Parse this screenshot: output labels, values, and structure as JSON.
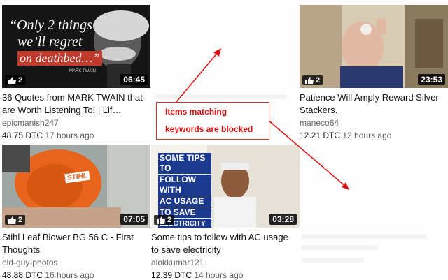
{
  "videos": [
    {
      "title": "36 Quotes from MARK TWAIN that are Worth Listening To! | Lif…",
      "channel": "epicmanish247",
      "dtc": "48.75 DTC",
      "age": "17 hours ago",
      "likes": "2",
      "duration": "06:45",
      "thumb_line1": "“Only 2 things",
      "thumb_line2": "we’ll regret",
      "thumb_line3": "on deathbed…”",
      "thumb_caption": "MARK TWAIN"
    },
    {
      "title": "Patience Will Amply Reward Silver Stackers.",
      "channel": "maneco64",
      "dtc": "12.21 DTC",
      "age": "12 hours ago",
      "likes": "2",
      "duration": "23:53"
    },
    {
      "title": "Stihl Leaf Blower BG 56 C - First Thoughts",
      "channel": "old-guy-photos",
      "dtc": "48.88 DTC",
      "age": "16 hours ago",
      "likes": "2",
      "duration": "07:05",
      "thumb_brand": "STIHL"
    },
    {
      "title": "Some tips to follow with AC usage to save electricity",
      "channel": "alokkumar121",
      "dtc": "12.39 DTC",
      "age": "14 hours ago",
      "likes": "2",
      "duration": "03:28",
      "thumb_lines": [
        "SOME TIPS TO",
        "FOLLOW WITH",
        "AC USAGE",
        "TO SAVE",
        "ELECTRICITY"
      ]
    }
  ],
  "annotation": {
    "line1": "Items matching",
    "line2": "keywords are blocked",
    "color": "#dd1111"
  }
}
